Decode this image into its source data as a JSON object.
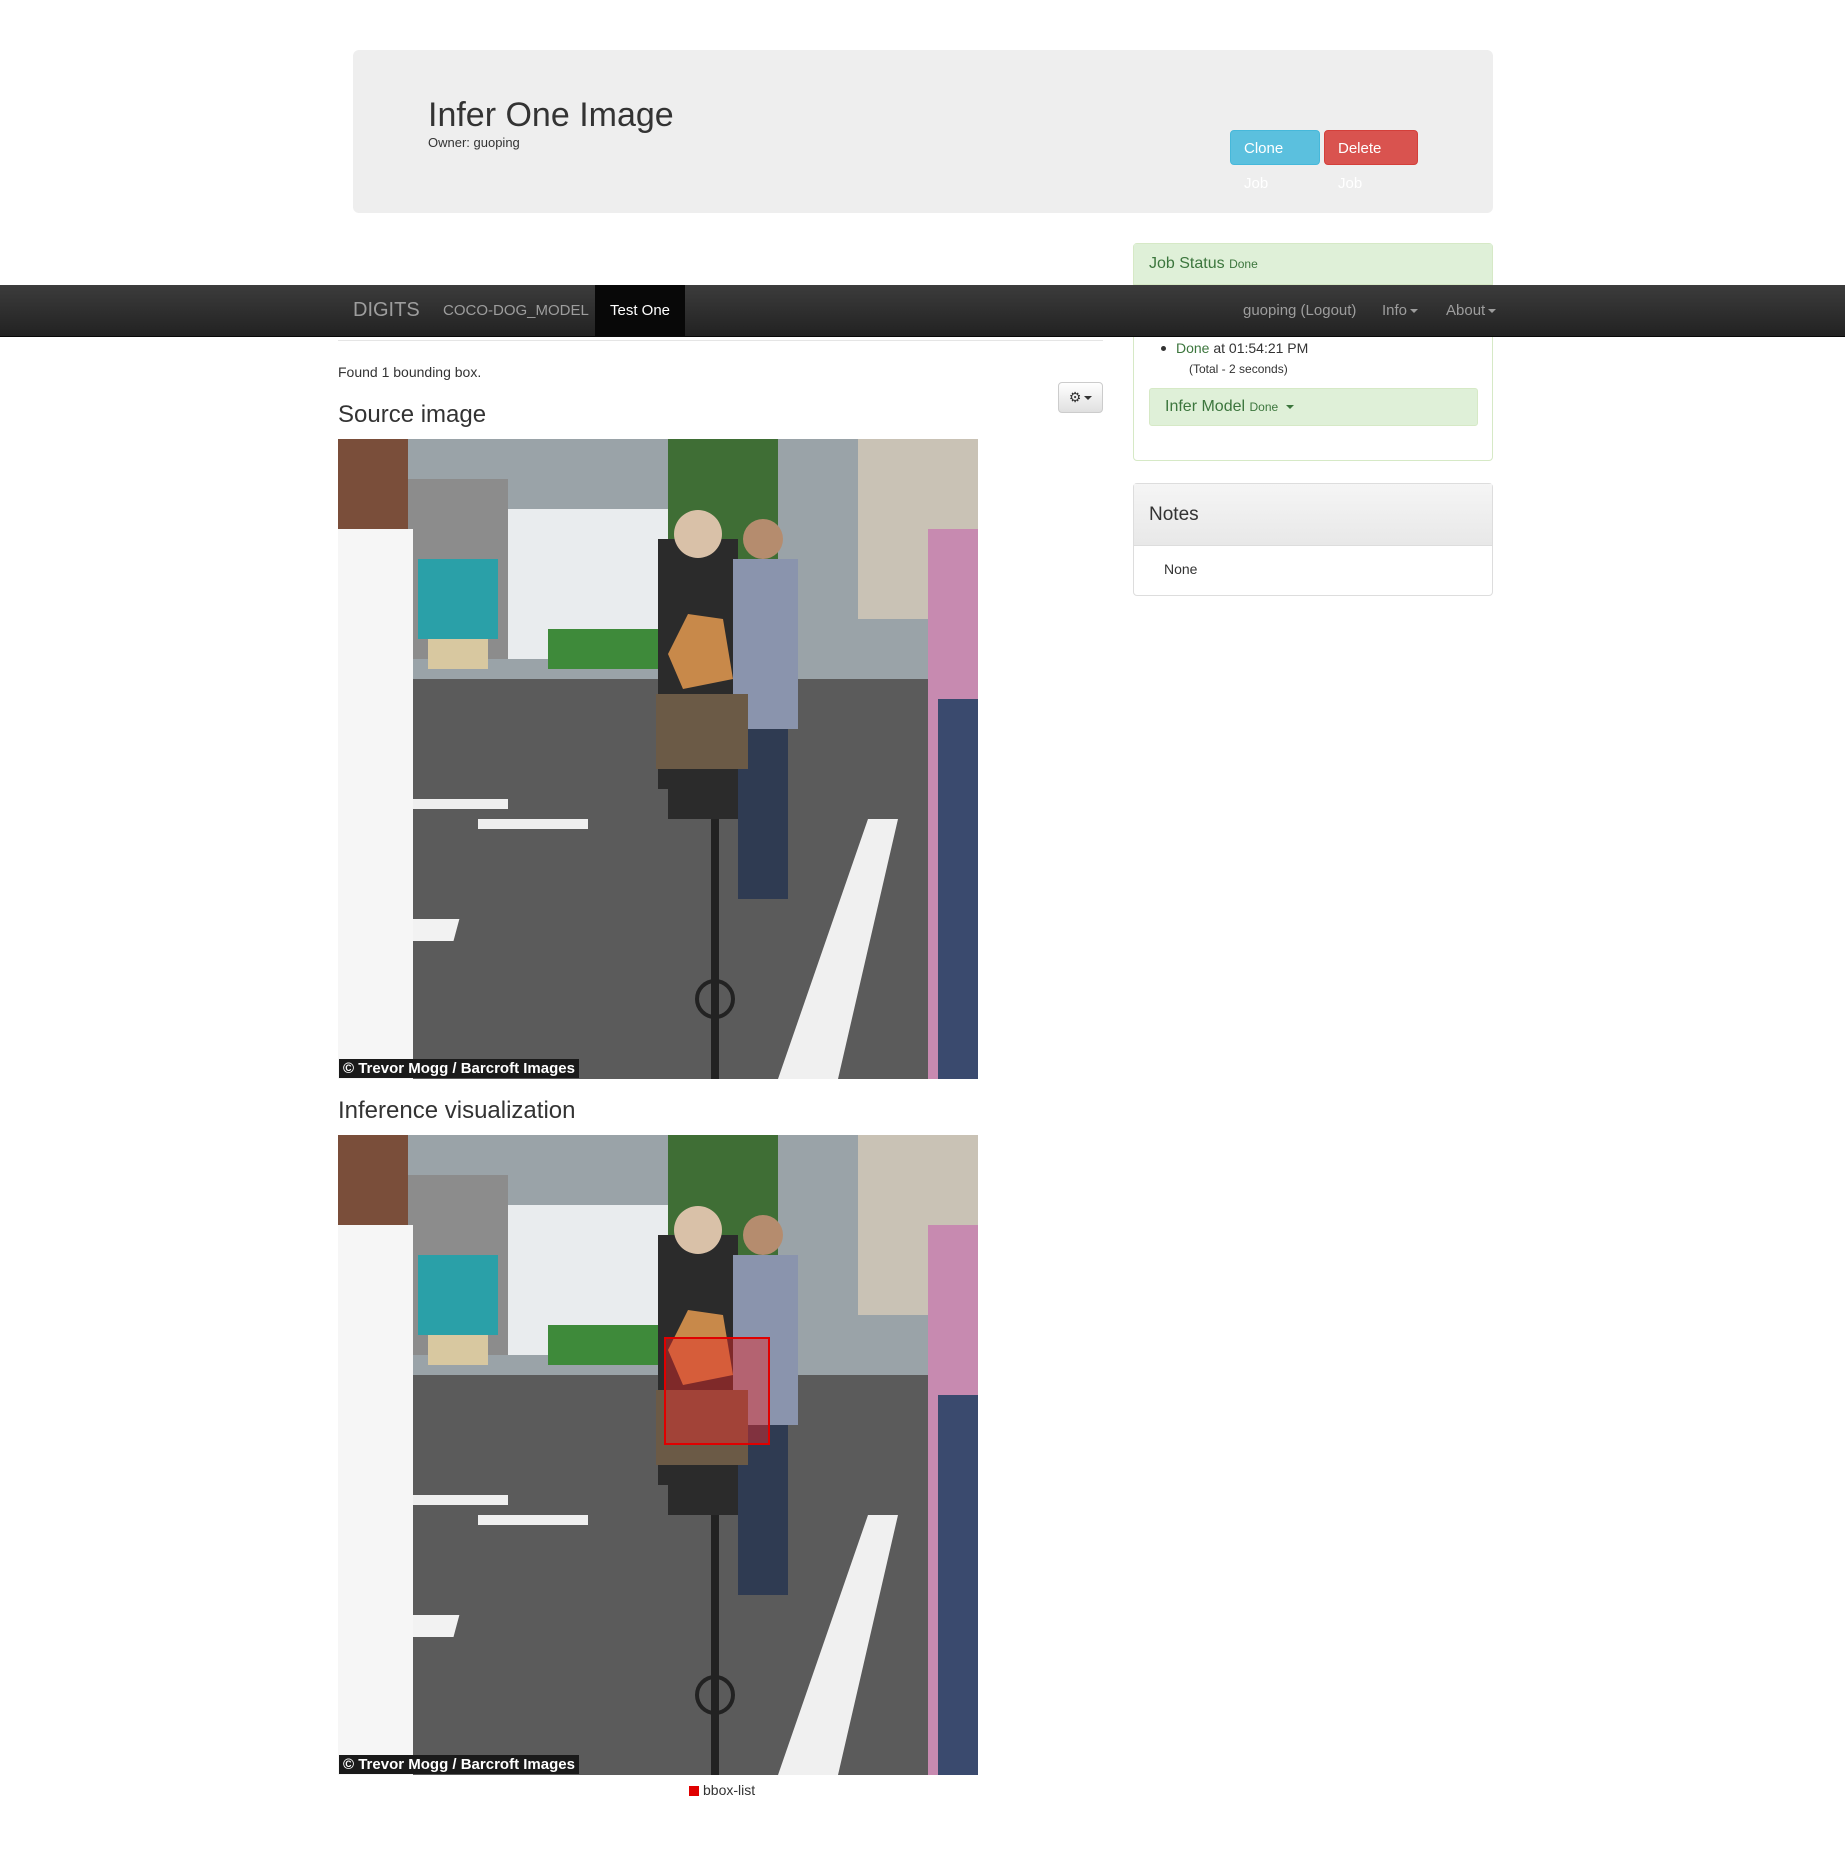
{
  "header": {
    "title": "Infer One Image",
    "owner": "Owner: guoping",
    "clone_label": "Clone Job",
    "delete_label": "Delete Job"
  },
  "navbar": {
    "brand": "DIGITS",
    "model": "COCO-DOG_MODEL",
    "active_tab": "Test One",
    "user": "guoping (Logout)",
    "info": "Info",
    "about": "About"
  },
  "job_status": {
    "heading": "Job Status",
    "state": "Done",
    "done_word": "Done",
    "done_time": "at 01:54:21 PM",
    "total": "(Total - 2 seconds)",
    "infer_model": "Infer Model",
    "infer_state": "Done"
  },
  "notes": {
    "heading": "Notes",
    "body": "None"
  },
  "results": {
    "found_text": "Found 1 bounding box.",
    "source_heading": "Source image",
    "inference_heading": "Inference visualization",
    "credit": "© Trevor Mogg / Barcroft Images",
    "legend_label": "bbox-list"
  },
  "colors": {
    "info_button": "#5bc0de",
    "danger_button": "#d9534f",
    "success_bg": "#dff0d8",
    "success_text": "#3c763d",
    "bbox": "#e00000"
  }
}
